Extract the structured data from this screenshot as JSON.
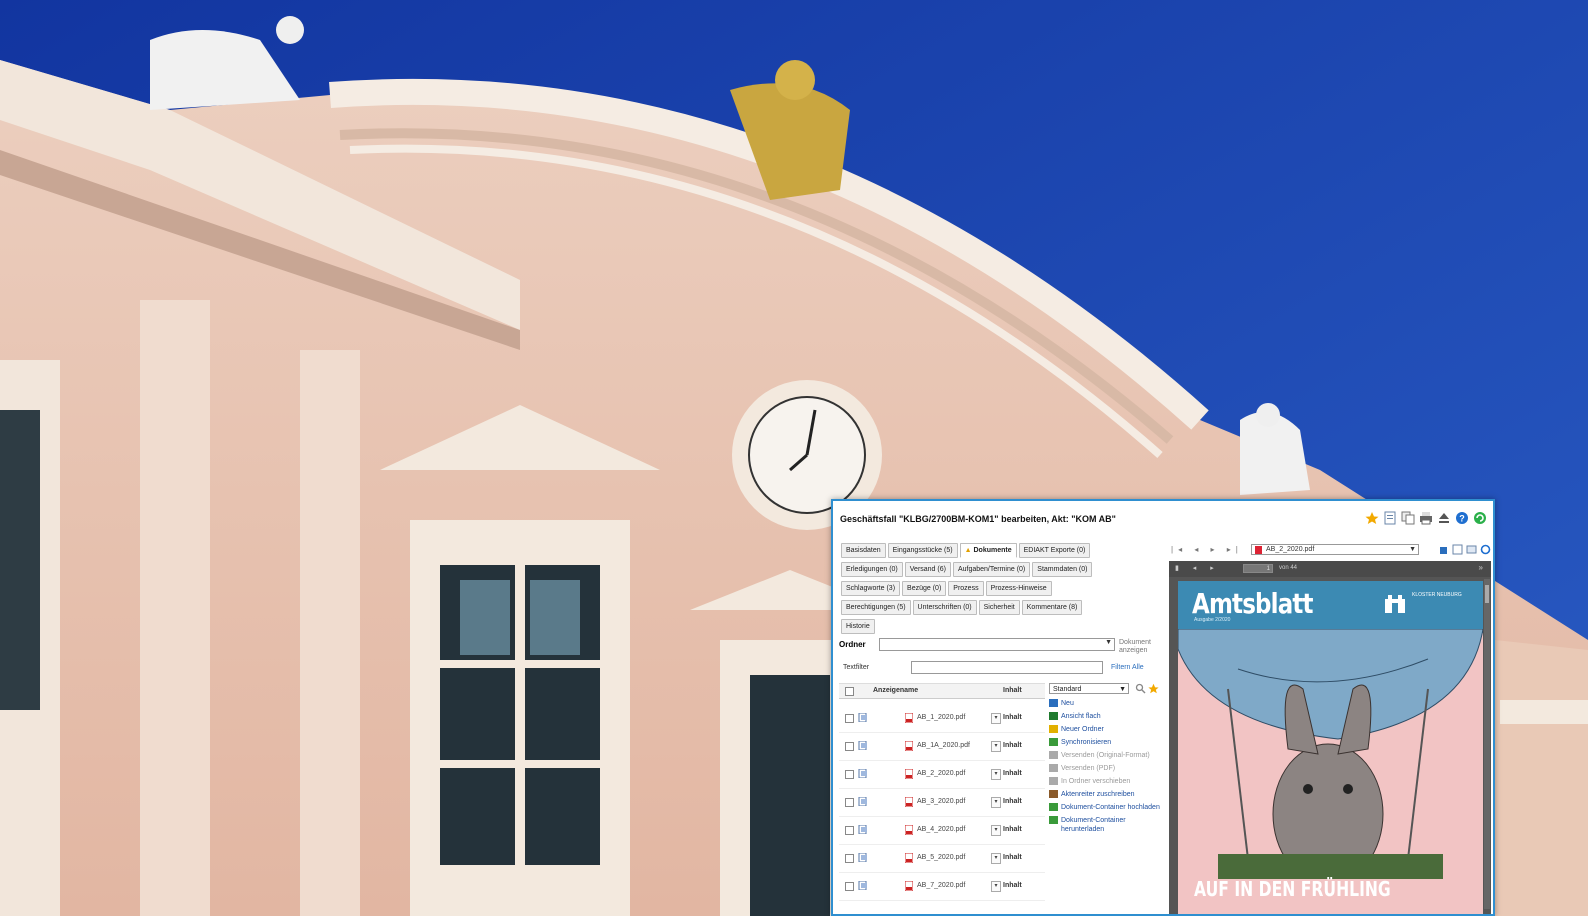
{
  "window": {
    "title": "Geschäftsfall \"KLBG/2700BM-KOM1\" bearbeiten, Akt: \"KOM AB\""
  },
  "tabs": {
    "row1": [
      "Basisdaten",
      "Eingangsstücke (5)",
      "Dokumente",
      "EDIAKT Exporte (0)"
    ],
    "row2": [
      "Erledigungen (0)",
      "Versand (6)",
      "Aufgaben/Termine (0)",
      "Stammdaten (0)"
    ],
    "row3": [
      "Schlagworte (3)",
      "Bezüge (0)",
      "Prozess",
      "Prozess-Hinweise"
    ],
    "row4": [
      "Berechtigungen (5)",
      "Unterschriften (0)",
      "Sicherheit",
      "Kommentare (8)"
    ],
    "row5": [
      "Historie"
    ]
  },
  "ordner": {
    "label": "Ordner",
    "link": "Dokument anzeigen"
  },
  "filter": {
    "label": "Textfilter",
    "value": "",
    "link_filter": "Filtern",
    "link_all": "Alle"
  },
  "grid": {
    "col_name": "Anzeigename",
    "col_content": "Inhalt",
    "rows": [
      {
        "file": "AB_1_2020.pdf",
        "content": "Inhalt"
      },
      {
        "file": "AB_1A_2020.pdf",
        "content": "Inhalt"
      },
      {
        "file": "AB_2_2020.pdf",
        "content": "Inhalt"
      },
      {
        "file": "AB_3_2020.pdf",
        "content": "Inhalt"
      },
      {
        "file": "AB_4_2020.pdf",
        "content": "Inhalt"
      },
      {
        "file": "AB_5_2020.pdf",
        "content": "Inhalt"
      },
      {
        "file": "AB_7_2020.pdf",
        "content": "Inhalt"
      }
    ]
  },
  "view": {
    "selected": "Standard"
  },
  "actions": [
    {
      "label": "Neu",
      "enabled": true,
      "color": "#2a6ebd"
    },
    {
      "label": "Ansicht flach",
      "enabled": true,
      "color": "#1f7a2e"
    },
    {
      "label": "Neuer Ordner",
      "enabled": true,
      "color": "#e2b000"
    },
    {
      "label": "Synchronisieren",
      "enabled": true,
      "color": "#3a9a3a"
    },
    {
      "label": "Versenden (Original-Format)",
      "enabled": false,
      "color": "#aaaaaa"
    },
    {
      "label": "Versenden (PDF)",
      "enabled": false,
      "color": "#aaaaaa"
    },
    {
      "label": "In Ordner verschieben",
      "enabled": false,
      "color": "#aaaaaa"
    },
    {
      "label": "Aktenreiter zuschreiben",
      "enabled": true,
      "color": "#8a5a2a"
    },
    {
      "label": "Dokument-Container hochladen",
      "enabled": true,
      "color": "#3a9a3a"
    },
    {
      "label": "Dokument-Container herunterladen",
      "enabled": true,
      "color": "#3a9a3a"
    }
  ],
  "viewer": {
    "selected_file": "AB_2_2020.pdf",
    "page_input": "1",
    "page_of": "von 44",
    "masthead": "Amtsblatt",
    "issue": "Ausgabe 2/2020",
    "city": "KLOSTER NEUBURG",
    "headline": "AUF IN DEN FRÜHLING"
  },
  "colors": {
    "window_border": "#2f8fd0",
    "banner": "#3c8ab3",
    "sky": "#1a3fa8",
    "facade": "#e8c3b1"
  }
}
